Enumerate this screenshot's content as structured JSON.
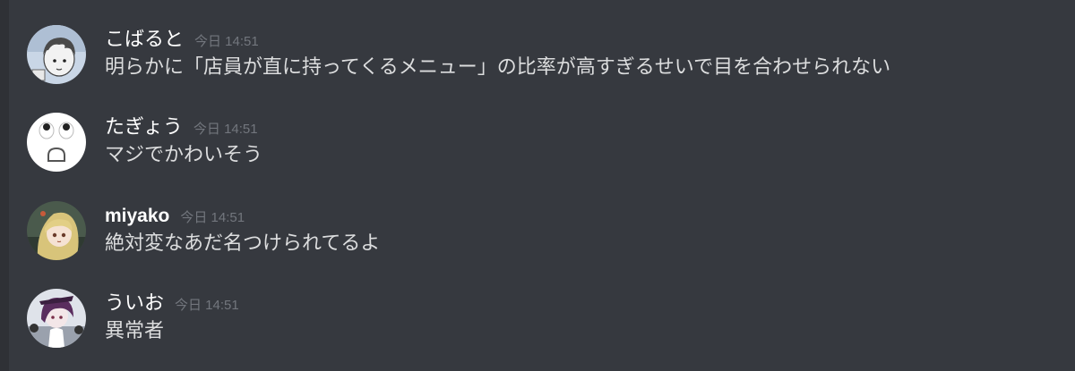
{
  "messages": [
    {
      "username": "こばると",
      "timestamp": "今日 14:51",
      "text": "明らかに「店員が直に持ってくるメニュー」の比率が高すぎるせいで目を合わせられない",
      "avatar_icon": "avatar-kobaruto-icon"
    },
    {
      "username": "たぎょう",
      "timestamp": "今日 14:51",
      "text": "マジでかわいそう",
      "avatar_icon": "avatar-tagyou-icon"
    },
    {
      "username": "miyako",
      "timestamp": "今日 14:51",
      "text": "絶対変なあだ名つけられてるよ",
      "avatar_icon": "avatar-miyako-icon"
    },
    {
      "username": "ういお",
      "timestamp": "今日 14:51",
      "text": "異常者",
      "avatar_icon": "avatar-uio-icon"
    }
  ],
  "colors": {
    "background": "#36393f",
    "username": "#ffffff",
    "message_text": "#dcddde",
    "timestamp": "#72767d"
  }
}
